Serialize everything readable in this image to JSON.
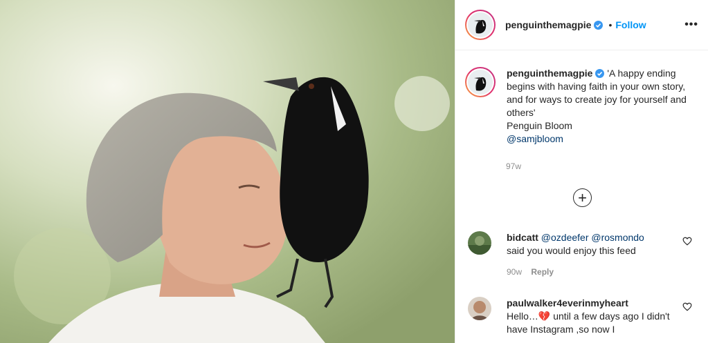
{
  "post": {
    "username": "penguinthemagpie",
    "follow_label": "Follow",
    "dot": "•",
    "more_label": "•••",
    "caption": "'A happy ending begins with having faith in your own story, and for ways to create joy for yourself and others'",
    "caption_sig": "Penguin Bloom",
    "caption_mention": "@samjbloom",
    "time": "97w",
    "load_more": "+"
  },
  "comments": [
    {
      "username": "bidcatt",
      "mentions": "@ozdeefer @rosmondo",
      "text": "said you would enjoy this feed",
      "time": "90w",
      "reply": "Reply"
    },
    {
      "username": "paulwalker4everinmyheart",
      "text_before": "Hello…",
      "emoji": "💔",
      "text_after": " until a few days ago I didn't have Instagram ,so now I"
    }
  ],
  "colors": {
    "accent": "#0095f6",
    "mention": "#00376b",
    "muted": "#8e8e8e"
  }
}
